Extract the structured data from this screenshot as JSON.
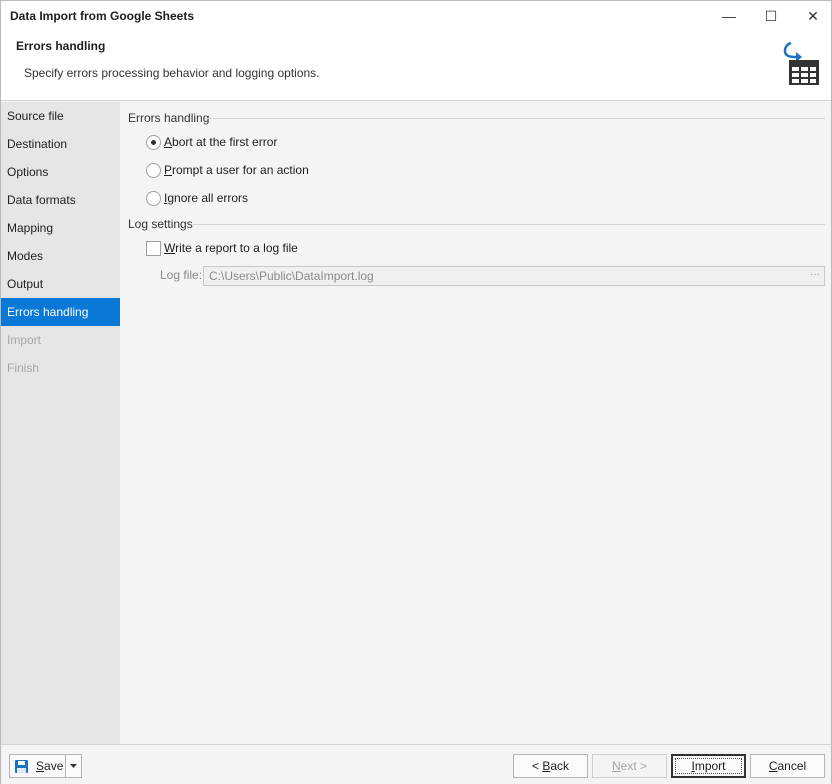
{
  "window": {
    "title": "Data Import from Google Sheets",
    "minimize_glyph": "—",
    "maximize_glyph": "☐",
    "close_glyph": "✕"
  },
  "header": {
    "title": "Errors handling",
    "description": "Specify errors processing behavior and logging options.",
    "icon": "import-table-icon"
  },
  "sidebar": {
    "items": [
      {
        "label": "Source file",
        "state": "normal"
      },
      {
        "label": "Destination",
        "state": "normal"
      },
      {
        "label": "Options",
        "state": "normal"
      },
      {
        "label": "Data formats",
        "state": "normal"
      },
      {
        "label": "Mapping",
        "state": "normal"
      },
      {
        "label": "Modes",
        "state": "normal"
      },
      {
        "label": "Output",
        "state": "normal"
      },
      {
        "label": "Errors handling",
        "state": "active"
      },
      {
        "label": "Import",
        "state": "disabled"
      },
      {
        "label": "Finish",
        "state": "disabled"
      }
    ]
  },
  "errors_group": {
    "label": "Errors handling",
    "options": [
      {
        "mnemonic": "A",
        "rest": "bort at the first error",
        "checked": true
      },
      {
        "mnemonic": "P",
        "rest": "rompt a user for an action",
        "checked": false
      },
      {
        "mnemonic": "I",
        "rest": "gnore all errors",
        "checked": false
      }
    ]
  },
  "log_group": {
    "label": "Log settings",
    "write_report": {
      "mnemonic": "W",
      "rest": "rite a report to a log file",
      "checked": false
    },
    "log_file_label": "Log file:",
    "log_file_value": "C:\\Users\\Public\\DataImport.log",
    "browse_glyph": "···"
  },
  "footer": {
    "save": {
      "mnemonic": "S",
      "rest": "ave"
    },
    "back": {
      "prefix": "< ",
      "mnemonic": "B",
      "rest": "ack"
    },
    "next": {
      "mnemonic": "N",
      "rest": "ext >"
    },
    "import": {
      "mnemonic": "I",
      "rest": "mport"
    },
    "cancel": {
      "mnemonic": "C",
      "rest": "ancel"
    }
  },
  "colors": {
    "accent": "#0a78d7",
    "icon_blue": "#1e73be",
    "icon_dark": "#333333"
  }
}
